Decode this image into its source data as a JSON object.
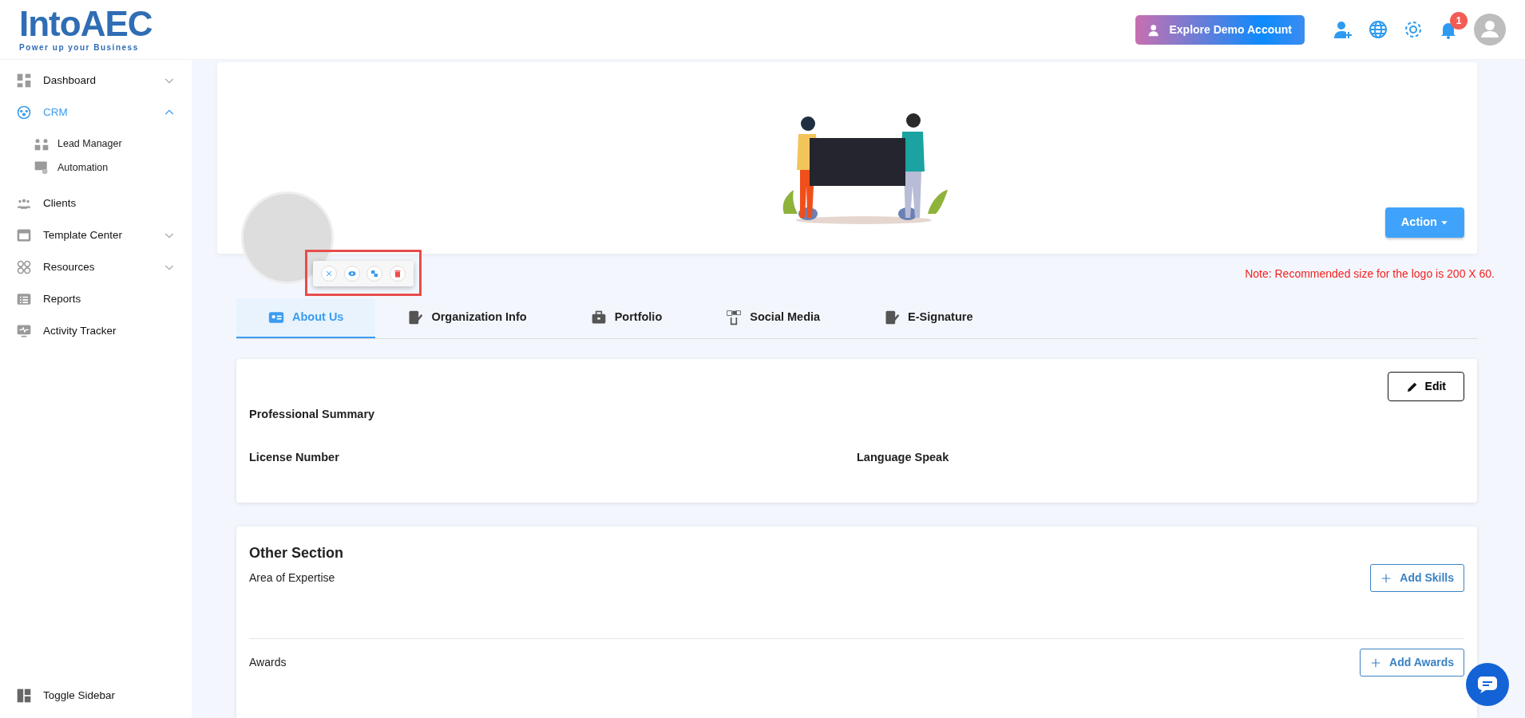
{
  "logo": {
    "name": "IntoAEC",
    "tagline": "Power up your Business"
  },
  "header": {
    "demo_button": "Explore Demo Account",
    "notification_count": "1"
  },
  "sidebar": {
    "items": [
      {
        "label": "Dashboard",
        "selected": false,
        "expanded": false
      },
      {
        "label": "CRM",
        "selected": true,
        "expanded": true,
        "children": [
          {
            "label": "Lead Manager"
          },
          {
            "label": "Automation"
          }
        ]
      },
      {
        "label": "Clients",
        "selected": false
      },
      {
        "label": "Template Center",
        "selected": false,
        "expanded": false
      },
      {
        "label": "Resources",
        "selected": false,
        "expanded": false
      },
      {
        "label": "Reports",
        "selected": false
      },
      {
        "label": "Activity Tracker",
        "selected": false
      }
    ],
    "toggle": "Toggle Sidebar"
  },
  "banner": {
    "action_button": "Action",
    "note": "Note: Recommended size for the logo is 200 X 60."
  },
  "tabs": [
    {
      "label": "About Us",
      "selected": true
    },
    {
      "label": "Organization Info",
      "selected": false
    },
    {
      "label": "Portfolio",
      "selected": false
    },
    {
      "label": "Social Media",
      "selected": false
    },
    {
      "label": "E-Signature",
      "selected": false
    }
  ],
  "about": {
    "edit_button": "Edit",
    "fields": [
      {
        "label": "Professional Summary"
      },
      {
        "label": "License Number"
      },
      {
        "label": "Language Speak"
      }
    ]
  },
  "other": {
    "title": "Other Section",
    "sections": [
      {
        "label": "Area of Expertise",
        "button": "Add Skills"
      },
      {
        "label": "Awards",
        "button": "Add Awards"
      }
    ]
  }
}
